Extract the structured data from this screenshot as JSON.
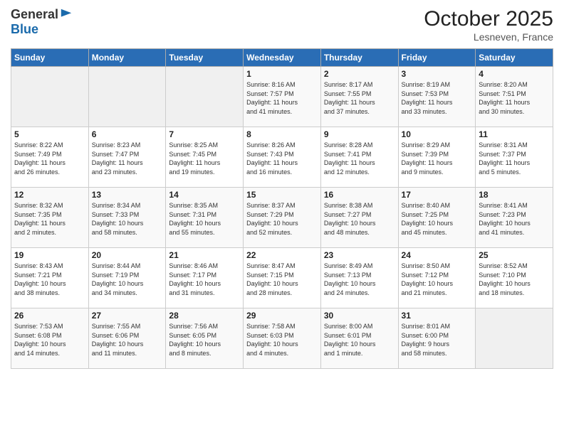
{
  "logo": {
    "general": "General",
    "blue": "Blue"
  },
  "header": {
    "month": "October 2025",
    "location": "Lesneven, France"
  },
  "days_of_week": [
    "Sunday",
    "Monday",
    "Tuesday",
    "Wednesday",
    "Thursday",
    "Friday",
    "Saturday"
  ],
  "weeks": [
    [
      {
        "day": "",
        "info": ""
      },
      {
        "day": "",
        "info": ""
      },
      {
        "day": "",
        "info": ""
      },
      {
        "day": "1",
        "info": "Sunrise: 8:16 AM\nSunset: 7:57 PM\nDaylight: 11 hours\nand 41 minutes."
      },
      {
        "day": "2",
        "info": "Sunrise: 8:17 AM\nSunset: 7:55 PM\nDaylight: 11 hours\nand 37 minutes."
      },
      {
        "day": "3",
        "info": "Sunrise: 8:19 AM\nSunset: 7:53 PM\nDaylight: 11 hours\nand 33 minutes."
      },
      {
        "day": "4",
        "info": "Sunrise: 8:20 AM\nSunset: 7:51 PM\nDaylight: 11 hours\nand 30 minutes."
      }
    ],
    [
      {
        "day": "5",
        "info": "Sunrise: 8:22 AM\nSunset: 7:49 PM\nDaylight: 11 hours\nand 26 minutes."
      },
      {
        "day": "6",
        "info": "Sunrise: 8:23 AM\nSunset: 7:47 PM\nDaylight: 11 hours\nand 23 minutes."
      },
      {
        "day": "7",
        "info": "Sunrise: 8:25 AM\nSunset: 7:45 PM\nDaylight: 11 hours\nand 19 minutes."
      },
      {
        "day": "8",
        "info": "Sunrise: 8:26 AM\nSunset: 7:43 PM\nDaylight: 11 hours\nand 16 minutes."
      },
      {
        "day": "9",
        "info": "Sunrise: 8:28 AM\nSunset: 7:41 PM\nDaylight: 11 hours\nand 12 minutes."
      },
      {
        "day": "10",
        "info": "Sunrise: 8:29 AM\nSunset: 7:39 PM\nDaylight: 11 hours\nand 9 minutes."
      },
      {
        "day": "11",
        "info": "Sunrise: 8:31 AM\nSunset: 7:37 PM\nDaylight: 11 hours\nand 5 minutes."
      }
    ],
    [
      {
        "day": "12",
        "info": "Sunrise: 8:32 AM\nSunset: 7:35 PM\nDaylight: 11 hours\nand 2 minutes."
      },
      {
        "day": "13",
        "info": "Sunrise: 8:34 AM\nSunset: 7:33 PM\nDaylight: 10 hours\nand 58 minutes."
      },
      {
        "day": "14",
        "info": "Sunrise: 8:35 AM\nSunset: 7:31 PM\nDaylight: 10 hours\nand 55 minutes."
      },
      {
        "day": "15",
        "info": "Sunrise: 8:37 AM\nSunset: 7:29 PM\nDaylight: 10 hours\nand 52 minutes."
      },
      {
        "day": "16",
        "info": "Sunrise: 8:38 AM\nSunset: 7:27 PM\nDaylight: 10 hours\nand 48 minutes."
      },
      {
        "day": "17",
        "info": "Sunrise: 8:40 AM\nSunset: 7:25 PM\nDaylight: 10 hours\nand 45 minutes."
      },
      {
        "day": "18",
        "info": "Sunrise: 8:41 AM\nSunset: 7:23 PM\nDaylight: 10 hours\nand 41 minutes."
      }
    ],
    [
      {
        "day": "19",
        "info": "Sunrise: 8:43 AM\nSunset: 7:21 PM\nDaylight: 10 hours\nand 38 minutes."
      },
      {
        "day": "20",
        "info": "Sunrise: 8:44 AM\nSunset: 7:19 PM\nDaylight: 10 hours\nand 34 minutes."
      },
      {
        "day": "21",
        "info": "Sunrise: 8:46 AM\nSunset: 7:17 PM\nDaylight: 10 hours\nand 31 minutes."
      },
      {
        "day": "22",
        "info": "Sunrise: 8:47 AM\nSunset: 7:15 PM\nDaylight: 10 hours\nand 28 minutes."
      },
      {
        "day": "23",
        "info": "Sunrise: 8:49 AM\nSunset: 7:13 PM\nDaylight: 10 hours\nand 24 minutes."
      },
      {
        "day": "24",
        "info": "Sunrise: 8:50 AM\nSunset: 7:12 PM\nDaylight: 10 hours\nand 21 minutes."
      },
      {
        "day": "25",
        "info": "Sunrise: 8:52 AM\nSunset: 7:10 PM\nDaylight: 10 hours\nand 18 minutes."
      }
    ],
    [
      {
        "day": "26",
        "info": "Sunrise: 7:53 AM\nSunset: 6:08 PM\nDaylight: 10 hours\nand 14 minutes."
      },
      {
        "day": "27",
        "info": "Sunrise: 7:55 AM\nSunset: 6:06 PM\nDaylight: 10 hours\nand 11 minutes."
      },
      {
        "day": "28",
        "info": "Sunrise: 7:56 AM\nSunset: 6:05 PM\nDaylight: 10 hours\nand 8 minutes."
      },
      {
        "day": "29",
        "info": "Sunrise: 7:58 AM\nSunset: 6:03 PM\nDaylight: 10 hours\nand 4 minutes."
      },
      {
        "day": "30",
        "info": "Sunrise: 8:00 AM\nSunset: 6:01 PM\nDaylight: 10 hours\nand 1 minute."
      },
      {
        "day": "31",
        "info": "Sunrise: 8:01 AM\nSunset: 6:00 PM\nDaylight: 9 hours\nand 58 minutes."
      },
      {
        "day": "",
        "info": ""
      }
    ]
  ]
}
